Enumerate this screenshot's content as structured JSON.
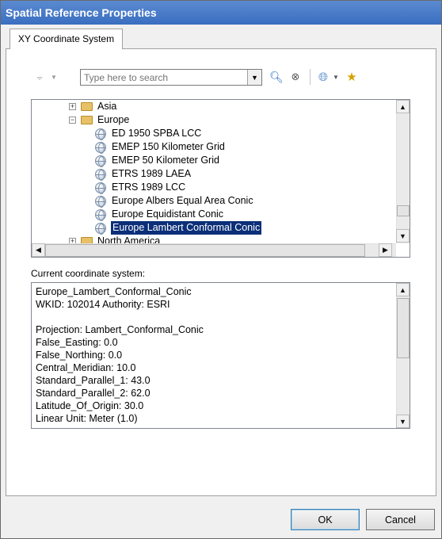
{
  "window": {
    "title": "Spatial Reference Properties"
  },
  "tabs": [
    {
      "label": "XY Coordinate System"
    }
  ],
  "toolbar": {
    "search_placeholder": "Type here to search",
    "icons": [
      "filter-icon",
      "search-icon",
      "clear-search-icon",
      "add-coordinate-system-icon",
      "add-to-favorites-icon"
    ]
  },
  "tree": {
    "rows": [
      {
        "label": "Asia",
        "type": "folder",
        "expander": "+"
      },
      {
        "label": "Europe",
        "type": "folder",
        "expander": "−"
      },
      {
        "label": "ED 1950 SPBA LCC",
        "type": "crs"
      },
      {
        "label": "EMEP 150 Kilometer Grid",
        "type": "crs"
      },
      {
        "label": "EMEP 50 Kilometer Grid",
        "type": "crs"
      },
      {
        "label": "ETRS 1989 LAEA",
        "type": "crs"
      },
      {
        "label": "ETRS 1989 LCC",
        "type": "crs"
      },
      {
        "label": "Europe Albers Equal Area Conic",
        "type": "crs"
      },
      {
        "label": "Europe Equidistant Conic",
        "type": "crs"
      },
      {
        "label": "Europe Lambert Conformal Conic",
        "type": "crs",
        "selected": true
      },
      {
        "label": "North America",
        "type": "folder",
        "expander": "+"
      }
    ]
  },
  "current": {
    "label": "Current coordinate system:",
    "lines": [
      "Europe_Lambert_Conformal_Conic",
      "WKID: 102014 Authority: ESRI",
      "",
      "Projection: Lambert_Conformal_Conic",
      "False_Easting: 0.0",
      "False_Northing: 0.0",
      "Central_Meridian: 10.0",
      "Standard_Parallel_1: 43.0",
      "Standard_Parallel_2: 62.0",
      "Latitude_Of_Origin: 30.0",
      "Linear Unit: Meter (1.0)"
    ]
  },
  "buttons": {
    "ok": "OK",
    "cancel": "Cancel"
  }
}
